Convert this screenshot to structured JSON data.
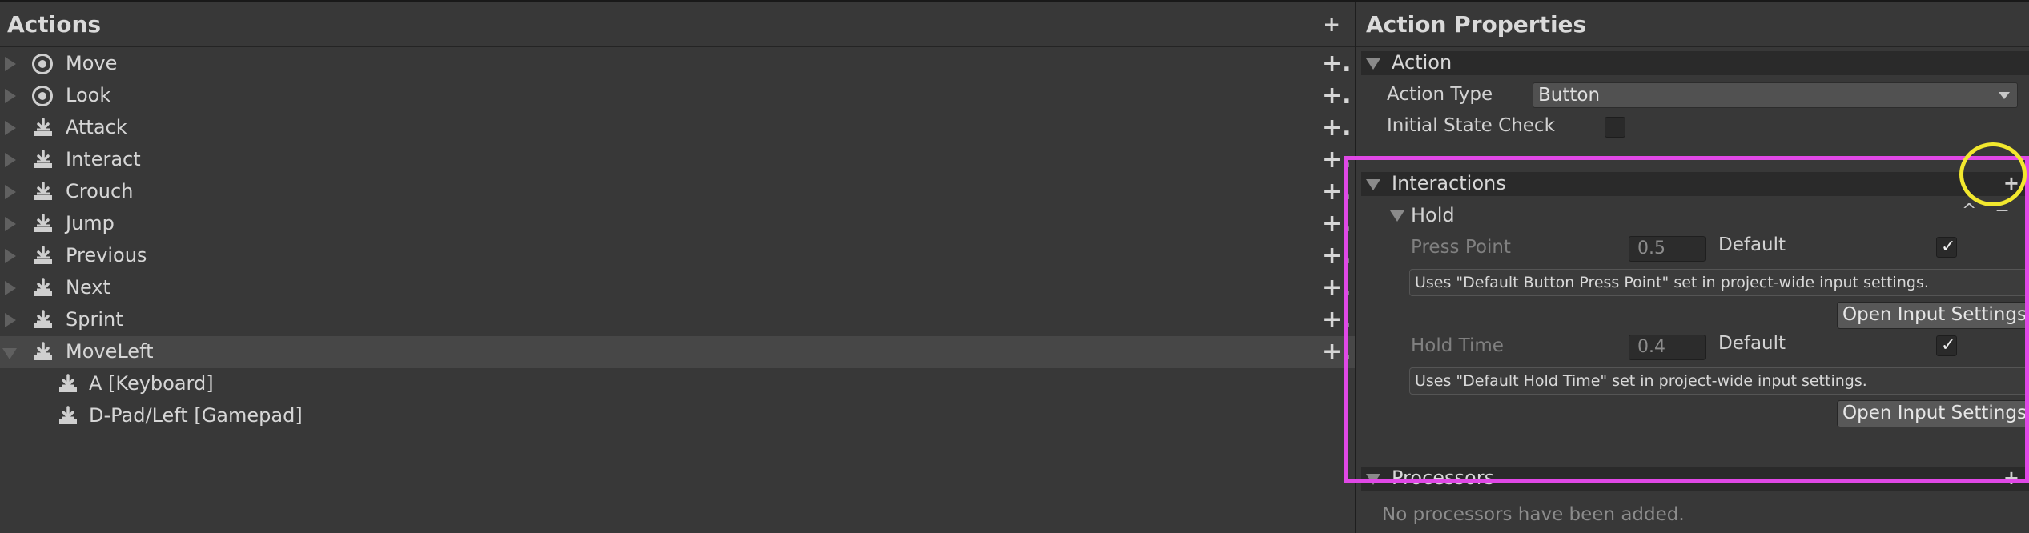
{
  "actions_panel": {
    "title": "Actions",
    "add_label": "+",
    "items": [
      {
        "label": "Move",
        "icon": "stick-icon",
        "expanded": false,
        "add": "+."
      },
      {
        "label": "Look",
        "icon": "stick-icon",
        "expanded": false,
        "add": "+."
      },
      {
        "label": "Attack",
        "icon": "button-icon",
        "expanded": false,
        "add": "+."
      },
      {
        "label": "Interact",
        "icon": "button-icon",
        "expanded": false,
        "add": "+."
      },
      {
        "label": "Crouch",
        "icon": "button-icon",
        "expanded": false,
        "add": "+."
      },
      {
        "label": "Jump",
        "icon": "button-icon",
        "expanded": false,
        "add": "+."
      },
      {
        "label": "Previous",
        "icon": "button-icon",
        "expanded": false,
        "add": "+."
      },
      {
        "label": "Next",
        "icon": "button-icon",
        "expanded": false,
        "add": "+."
      },
      {
        "label": "Sprint",
        "icon": "button-icon",
        "expanded": false,
        "add": "+."
      },
      {
        "label": "MoveLeft",
        "icon": "button-icon",
        "expanded": true,
        "selected": true,
        "add": "+."
      }
    ],
    "bindings": [
      {
        "label": "A [Keyboard]",
        "icon": "button-icon"
      },
      {
        "label": "D-Pad/Left [Gamepad]",
        "icon": "button-icon"
      }
    ]
  },
  "properties_panel": {
    "title": "Action Properties",
    "action_section": {
      "title": "Action",
      "action_type_label": "Action Type",
      "action_type_value": "Button",
      "initial_state_label": "Initial State Check",
      "initial_state_checked": false
    },
    "interactions_section": {
      "title": "Interactions",
      "add_label": "+",
      "hold": {
        "title": "Hold",
        "controls": "^˅−",
        "press_point_label": "Press Point",
        "press_point_value": "0.5",
        "press_point_default_label": "Default",
        "press_point_default_checked": true,
        "press_point_help": "Uses \"Default Button Press Point\" set in project-wide input settings.",
        "open_settings_label_1": "Open Input Settings",
        "hold_time_label": "Hold Time",
        "hold_time_value": "0.4",
        "hold_time_default_label": "Default",
        "hold_time_default_checked": true,
        "hold_time_help": "Uses \"Default Hold Time\" set in project-wide input settings.",
        "open_settings_label_2": "Open Input Settings"
      }
    },
    "processors_section": {
      "title": "Processors",
      "add_label": "+",
      "empty_text": "No processors have been added."
    }
  },
  "colors": {
    "highlight_rect": "#e048e6",
    "highlight_circle": "#f2e82e",
    "panel_bg": "#383838",
    "selected_row": "#474747"
  }
}
